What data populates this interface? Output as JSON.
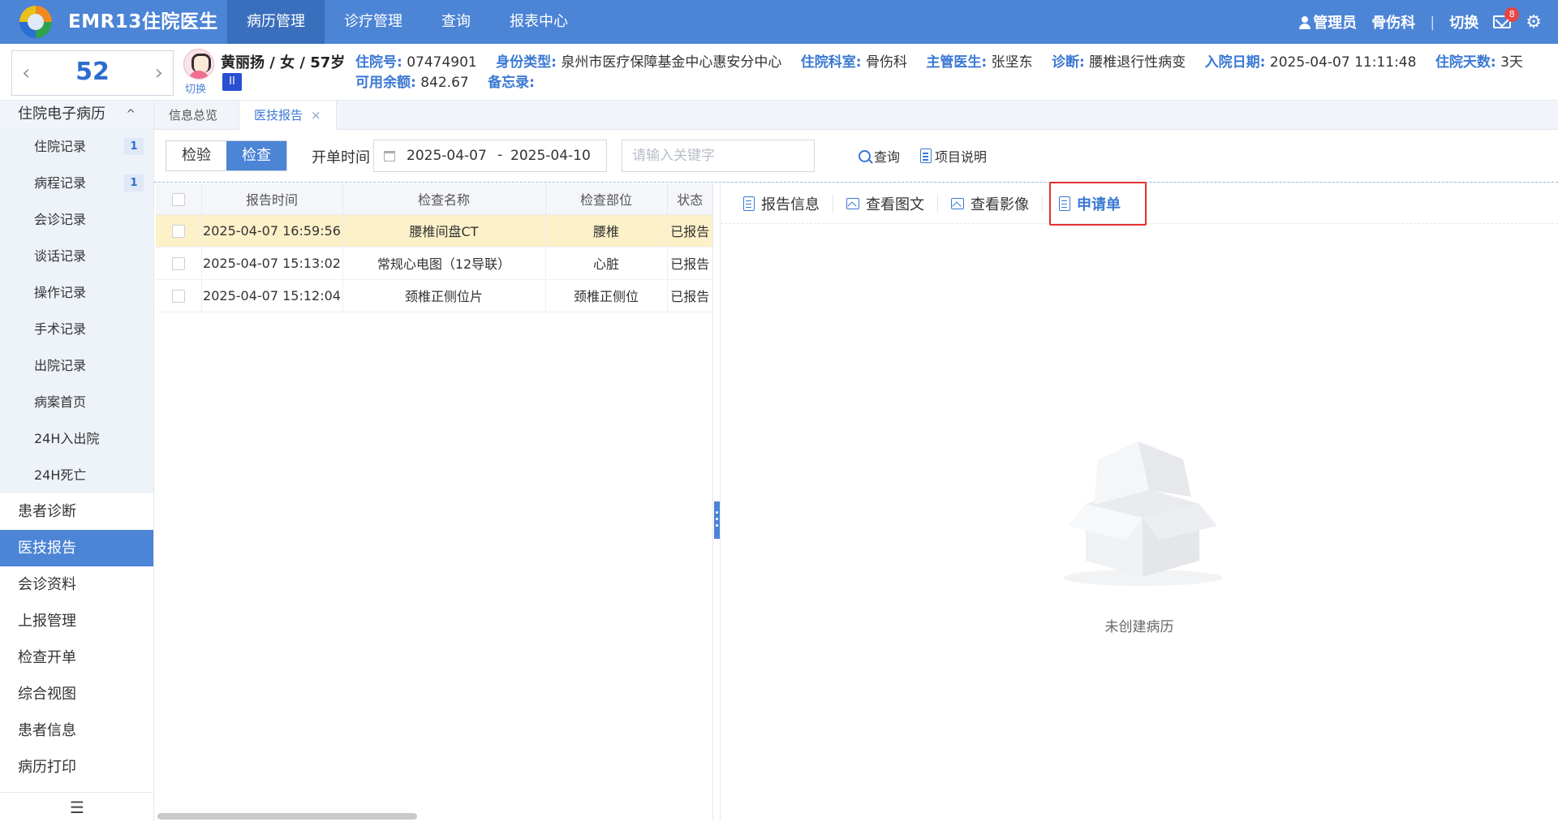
{
  "app": {
    "title": "EMR13住院医生"
  },
  "nav": {
    "tabs": [
      "病历管理",
      "诊疗管理",
      "查询",
      "报表中心"
    ],
    "active_index": 0
  },
  "header_right": {
    "user": "管理员",
    "dept": "骨伤科",
    "switch": "切换",
    "separator": "|",
    "mail_count": "8"
  },
  "bed": {
    "number": "52",
    "prev": "‹",
    "next": "›"
  },
  "patient": {
    "name_line": "黄丽扬 / 女 / 57岁",
    "switch_label": "切换",
    "level": "II",
    "fields_row1": [
      {
        "label": "住院号:",
        "value": "07474901"
      },
      {
        "label": "身份类型:",
        "value": "泉州市医疗保障基金中心惠安分中心"
      },
      {
        "label": "住院科室:",
        "value": "骨伤科"
      },
      {
        "label": "主管医生:",
        "value": "张坚东"
      },
      {
        "label": "诊断:",
        "value": "腰椎退行性病变"
      },
      {
        "label": "入院日期:",
        "value": "2025-04-07 11:11:48"
      },
      {
        "label": "住院天数:",
        "value": "3天"
      }
    ],
    "fields_row2": [
      {
        "label": "可用余额:",
        "value": "842.67"
      },
      {
        "label": "备忘录:",
        "value": ""
      }
    ]
  },
  "sidebar": {
    "group_label": "住院电子病历",
    "group_caret": "^",
    "sub_items": [
      {
        "label": "住院记录",
        "count": "1"
      },
      {
        "label": "病程记录",
        "count": "1"
      },
      {
        "label": "会诊记录",
        "count": ""
      },
      {
        "label": "谈话记录",
        "count": ""
      },
      {
        "label": "操作记录",
        "count": ""
      },
      {
        "label": "手术记录",
        "count": ""
      },
      {
        "label": "出院记录",
        "count": ""
      },
      {
        "label": "病案首页",
        "count": ""
      },
      {
        "label": "24H入出院",
        "count": ""
      },
      {
        "label": "24H死亡",
        "count": ""
      }
    ],
    "items": [
      "患者诊断",
      "医技报告",
      "会诊资料",
      "上报管理",
      "检查开单",
      "综合视图",
      "患者信息",
      "病历打印"
    ],
    "active_item": "医技报告",
    "collapse_glyph": "☰"
  },
  "tabs": [
    {
      "label": "信息总览"
    },
    {
      "label": "医技报告",
      "close": "×"
    }
  ],
  "toolbar": {
    "seg": [
      "检验",
      "检查"
    ],
    "seg_active": 1,
    "date_label": "开单时间",
    "date_from": "2025-04-07",
    "date_sep": "-",
    "date_to": "2025-04-10",
    "keyword_placeholder": "请输入关键字",
    "query_label": "查询",
    "help_label": "项目说明"
  },
  "table": {
    "columns": [
      "报告时间",
      "检查名称",
      "检查部位",
      "状态"
    ],
    "rows": [
      {
        "time": "2025-04-07 16:59:56",
        "name": "腰椎间盘CT",
        "part": "腰椎",
        "status": "已报告"
      },
      {
        "time": "2025-04-07 15:13:02",
        "name": "常规心电图（12导联）",
        "part": "心脏",
        "status": "已报告"
      },
      {
        "time": "2025-04-07 15:12:04",
        "name": "颈椎正侧位片",
        "part": "颈椎正侧位",
        "status": "已报告"
      }
    ],
    "selected_row": 0
  },
  "right_panel": {
    "tabs": [
      "报告信息",
      "查看图文",
      "查看影像",
      "申请单"
    ],
    "active_tab": 3,
    "empty_text": "未创建病历"
  },
  "colors": {
    "primary": "#4c84d6",
    "highlight_border": "#e53030",
    "selected_row": "#fdf1c9"
  }
}
